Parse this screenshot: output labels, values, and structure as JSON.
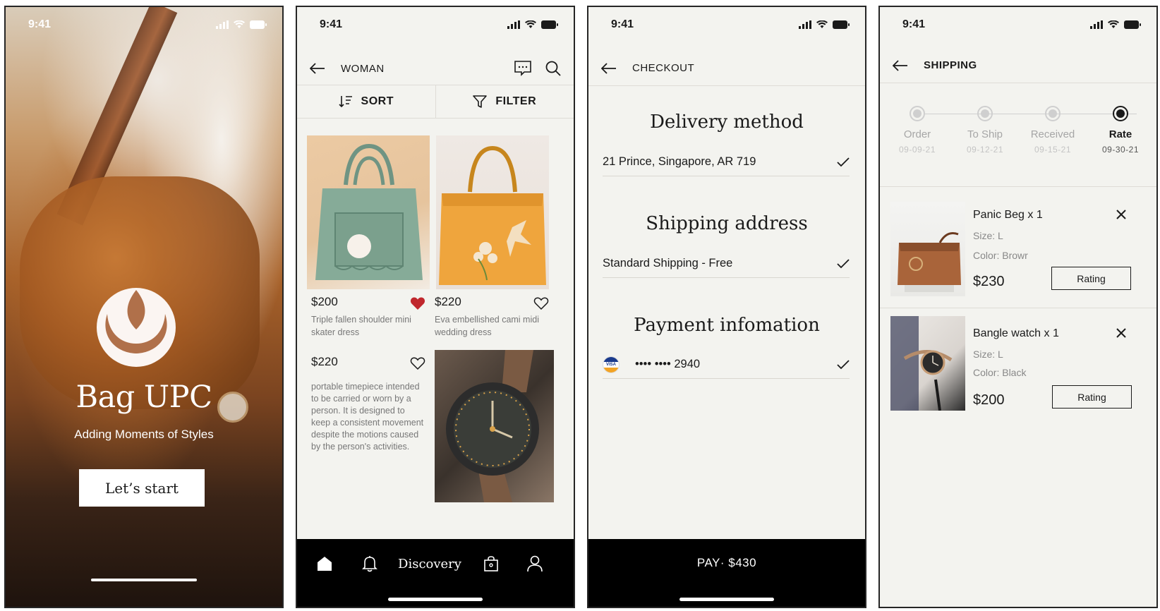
{
  "status": {
    "time": "9:41"
  },
  "splash": {
    "brand": "Bag UPC",
    "tagline": "Adding Moments of Styles",
    "start_label": "Let’s start"
  },
  "woman": {
    "title": "WOMAN",
    "sort_label": "SORT",
    "filter_label": "FILTER",
    "products": [
      {
        "price": "$200",
        "name": "Triple fallen shoulder mini skater dress",
        "liked": true
      },
      {
        "price": "$220",
        "name": "Eva embellished cami midi wedding dress",
        "liked": false
      },
      {
        "price": "$220",
        "name": "portable timepiece intended to be carried or worn by a person. It is designed to keep a consistent movement despite the motions caused by the person's activities.",
        "liked": false
      }
    ],
    "nav": {
      "discovery_label": "Discovery"
    }
  },
  "checkout": {
    "title": "CHECKOUT",
    "delivery_heading": "Delivery method",
    "delivery_value": "21 Prince, Singapore, AR 719",
    "shipping_heading": "Shipping address",
    "shipping_value": "Standard Shipping - Free",
    "payment_heading": "Payment infomation",
    "card_brand": "VISA",
    "card_masked": "•••• •••• 2940",
    "pay_label": "PAY· $430"
  },
  "shipping": {
    "title": "SHIPPING",
    "steps": [
      {
        "label": "Order",
        "date": "09-09-21",
        "active": false
      },
      {
        "label": "To Ship",
        "date": "09-12-21",
        "active": false
      },
      {
        "label": "Received",
        "date": "09-15-21",
        "active": false
      },
      {
        "label": "Rate",
        "date": "09-30-21",
        "active": true
      }
    ],
    "orders": [
      {
        "name": "Panic Beg x 1",
        "size": "Size: L",
        "color": "Color: Browr",
        "price": "$230",
        "rating_label": "Rating"
      },
      {
        "name": "Bangle watch x 1",
        "size": "Size: L",
        "color": "Color: Black",
        "price": "$200",
        "rating_label": "Rating"
      }
    ]
  },
  "colors": {
    "accent_heart": "#c0272d",
    "dark": "#000000",
    "screen_bg": "#f3f3ef"
  }
}
